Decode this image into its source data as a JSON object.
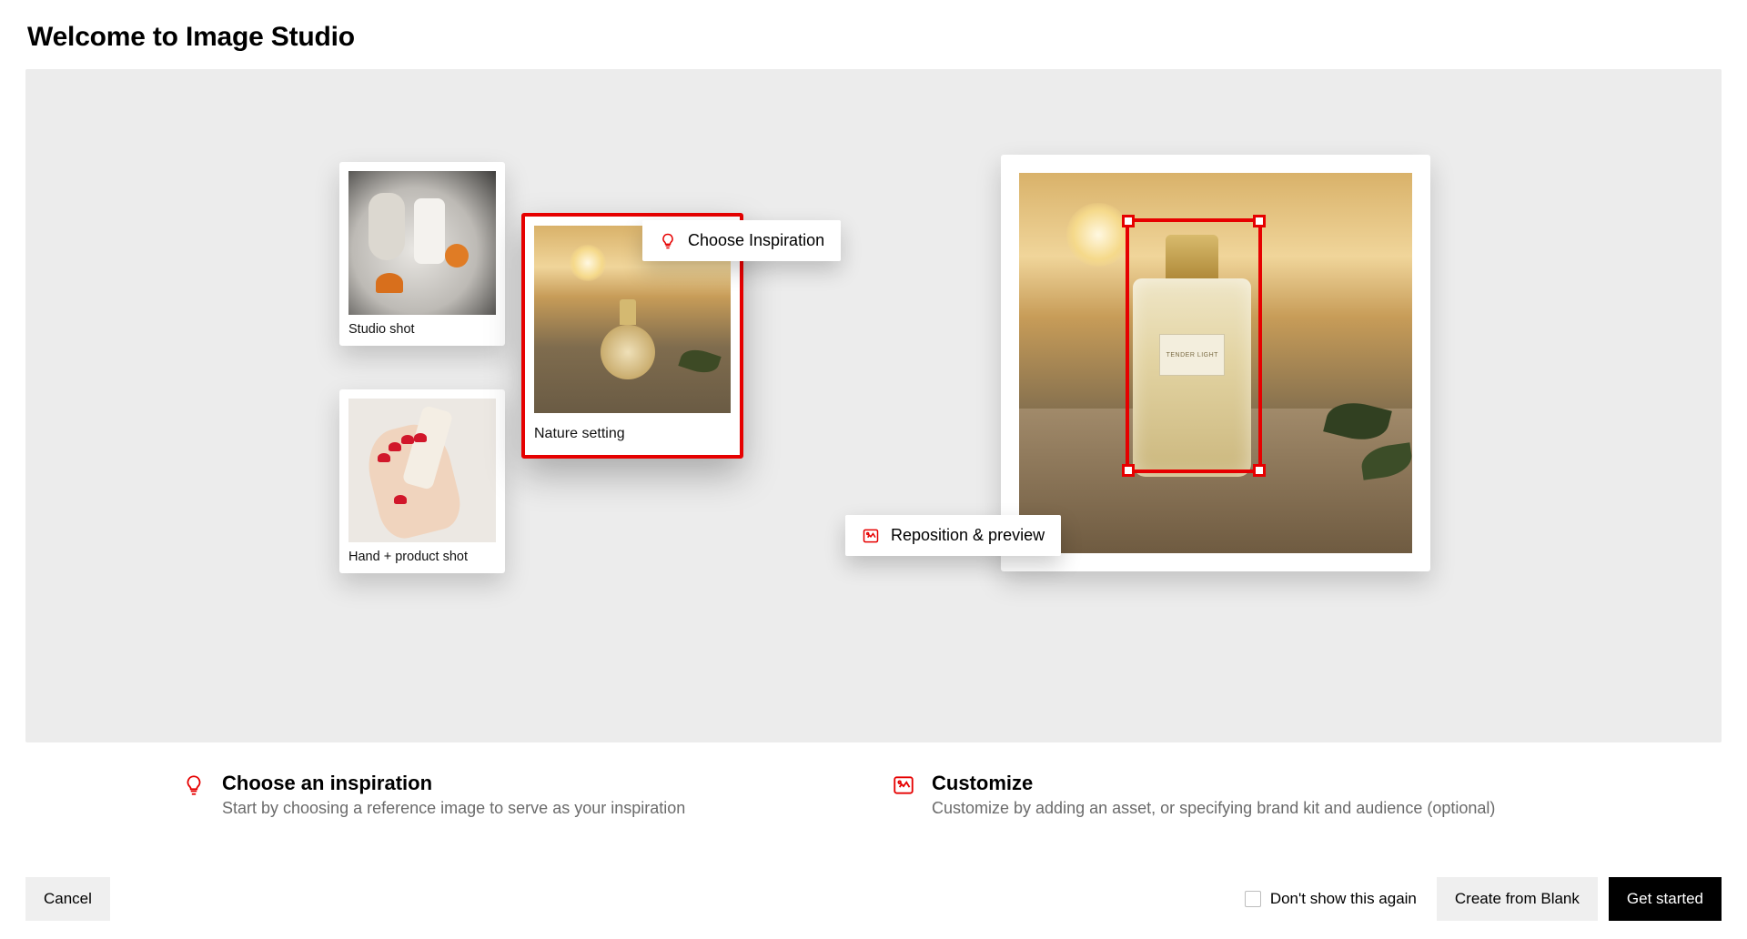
{
  "title": "Welcome to Image Studio",
  "hero": {
    "cards": {
      "studio": {
        "label": "Studio shot"
      },
      "nature": {
        "label": "Nature setting"
      },
      "hand": {
        "label": "Hand + product shot"
      }
    },
    "pills": {
      "choose": {
        "label": "Choose Inspiration",
        "icon": "lightbulb-icon"
      },
      "reposition": {
        "label": "Reposition & preview",
        "icon": "image-edit-icon"
      }
    },
    "preview": {
      "product_label": "TENDER LIGHT"
    }
  },
  "instructions": {
    "choose": {
      "icon": "lightbulb-icon",
      "title": "Choose an inspiration",
      "subtitle": "Start by choosing a reference image to serve as your inspiration"
    },
    "customize": {
      "icon": "image-edit-icon",
      "title": "Customize",
      "subtitle": "Customize by adding an asset, or specifying brand kit and audience (optional)"
    }
  },
  "footer": {
    "cancel": "Cancel",
    "dont_show": "Don't show this again",
    "create_blank": "Create from Blank",
    "get_started": "Get started"
  },
  "colors": {
    "accent": "#e60000"
  }
}
